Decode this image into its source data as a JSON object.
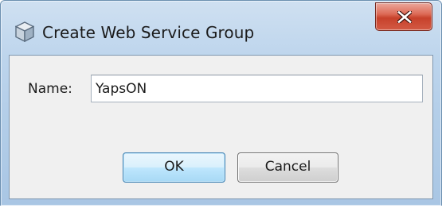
{
  "window": {
    "title": "Create Web Service Group",
    "icon": "cube-icon",
    "close_icon": "x-close-icon"
  },
  "form": {
    "name_label": "Name:",
    "name_value": "YapsON"
  },
  "buttons": {
    "ok_label": "OK",
    "cancel_label": "Cancel"
  },
  "colors": {
    "frame": "#b8d0ea",
    "close_button": "#c7412b",
    "default_button_border": "#3c7fb1",
    "client_background": "#f0f0f0"
  }
}
